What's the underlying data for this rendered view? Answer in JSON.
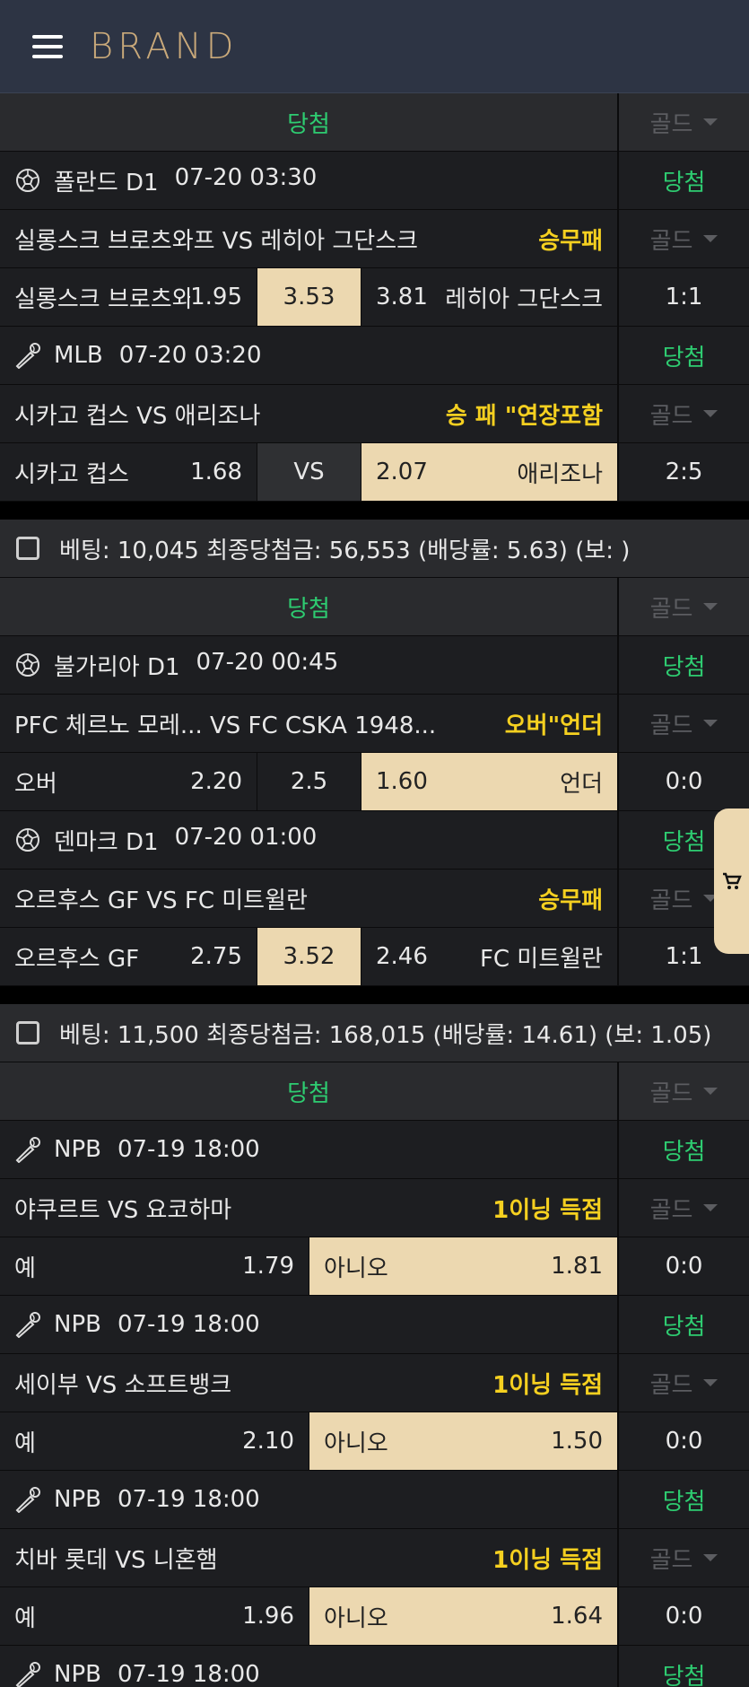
{
  "brand": "BRAND",
  "won_label": "당첨",
  "gold_label": "골드",
  "vs_label": "VS",
  "groups": [
    {
      "rows": [
        {
          "kind": "result"
        },
        {
          "kind": "league",
          "sport": "soccer",
          "league": "폴란드 D1",
          "time": "07-20 03:30",
          "status": "당첨"
        },
        {
          "kind": "match",
          "title": "실롱스크 브로츠와프 VS 레히아 그단스크",
          "type": "승무패"
        },
        {
          "kind": "odds3",
          "home": "실롱스크 브로츠와프",
          "home_odds": "1.95",
          "mid": "3.53",
          "away_odds": "3.81",
          "away": "레히아 그단스크",
          "score": "1:1",
          "sel": "mid"
        },
        {
          "kind": "league",
          "sport": "baseball",
          "league": "MLB",
          "time": "07-20 03:20",
          "status": "당첨"
        },
        {
          "kind": "match",
          "title": "시카고 컵스 VS 애리조나",
          "type": "승 패 \"연장포함"
        },
        {
          "kind": "odds3",
          "home": "시카고 컵스",
          "home_odds": "1.68",
          "mid": "VS",
          "away_odds": "2.07",
          "away": "애리조나",
          "score": "2:5",
          "sel": "away"
        }
      ]
    },
    {
      "summary": "베팅: 10,045 최종당첨금: 56,553 (배당률: 5.63) (보: )",
      "rows": [
        {
          "kind": "result"
        },
        {
          "kind": "league",
          "sport": "soccer",
          "league": "불가리아 D1",
          "time": "07-20 00:45",
          "status": "당첨"
        },
        {
          "kind": "match",
          "title": "PFC 체르노 모레...  VS FC CSKA 1948...",
          "type": "오버\"언더"
        },
        {
          "kind": "odds3",
          "home": "오버",
          "home_odds": "2.20",
          "mid": "2.5",
          "away_odds": "1.60",
          "away": "언더",
          "score": "0:0",
          "sel": "away"
        },
        {
          "kind": "league",
          "sport": "soccer",
          "league": "덴마크 D1",
          "time": "07-20 01:00",
          "status": "당첨"
        },
        {
          "kind": "match",
          "title": "오르후스 GF VS FC 미트윌란",
          "type": "승무패"
        },
        {
          "kind": "odds3",
          "home": "오르후스 GF",
          "home_odds": "2.75",
          "mid": "3.52",
          "away_odds": "2.46",
          "away": "FC 미트윌란",
          "score": "1:1",
          "sel": "mid"
        }
      ]
    },
    {
      "summary": "베팅: 11,500 최종당첨금: 168,015 (배당률: 14.61) (보: 1.05)",
      "rows": [
        {
          "kind": "result"
        },
        {
          "kind": "league",
          "sport": "baseball",
          "league": "NPB",
          "time": "07-19 18:00",
          "status": "당첨"
        },
        {
          "kind": "match",
          "title": "야쿠르트 VS 요코하마",
          "type": "1이닝 득점"
        },
        {
          "kind": "odds2",
          "home": "예",
          "home_odds": "1.79",
          "away": "아니오",
          "away_odds": "1.81",
          "score": "0:0"
        },
        {
          "kind": "league",
          "sport": "baseball",
          "league": "NPB",
          "time": "07-19 18:00",
          "status": "당첨"
        },
        {
          "kind": "match",
          "title": "세이부 VS 소프트뱅크",
          "type": "1이닝 득점"
        },
        {
          "kind": "odds2",
          "home": "예",
          "home_odds": "2.10",
          "away": "아니오",
          "away_odds": "1.50",
          "score": "0:0"
        },
        {
          "kind": "league",
          "sport": "baseball",
          "league": "NPB",
          "time": "07-19 18:00",
          "status": "당첨"
        },
        {
          "kind": "match",
          "title": "치바 롯데 VS 니혼햄",
          "type": "1이닝 득점"
        },
        {
          "kind": "odds2",
          "home": "예",
          "home_odds": "1.96",
          "away": "아니오",
          "away_odds": "1.64",
          "score": "0:0"
        },
        {
          "kind": "league",
          "sport": "baseball",
          "league": "NPB",
          "time": "07-19 18:00",
          "status": "당첨"
        }
      ]
    }
  ]
}
